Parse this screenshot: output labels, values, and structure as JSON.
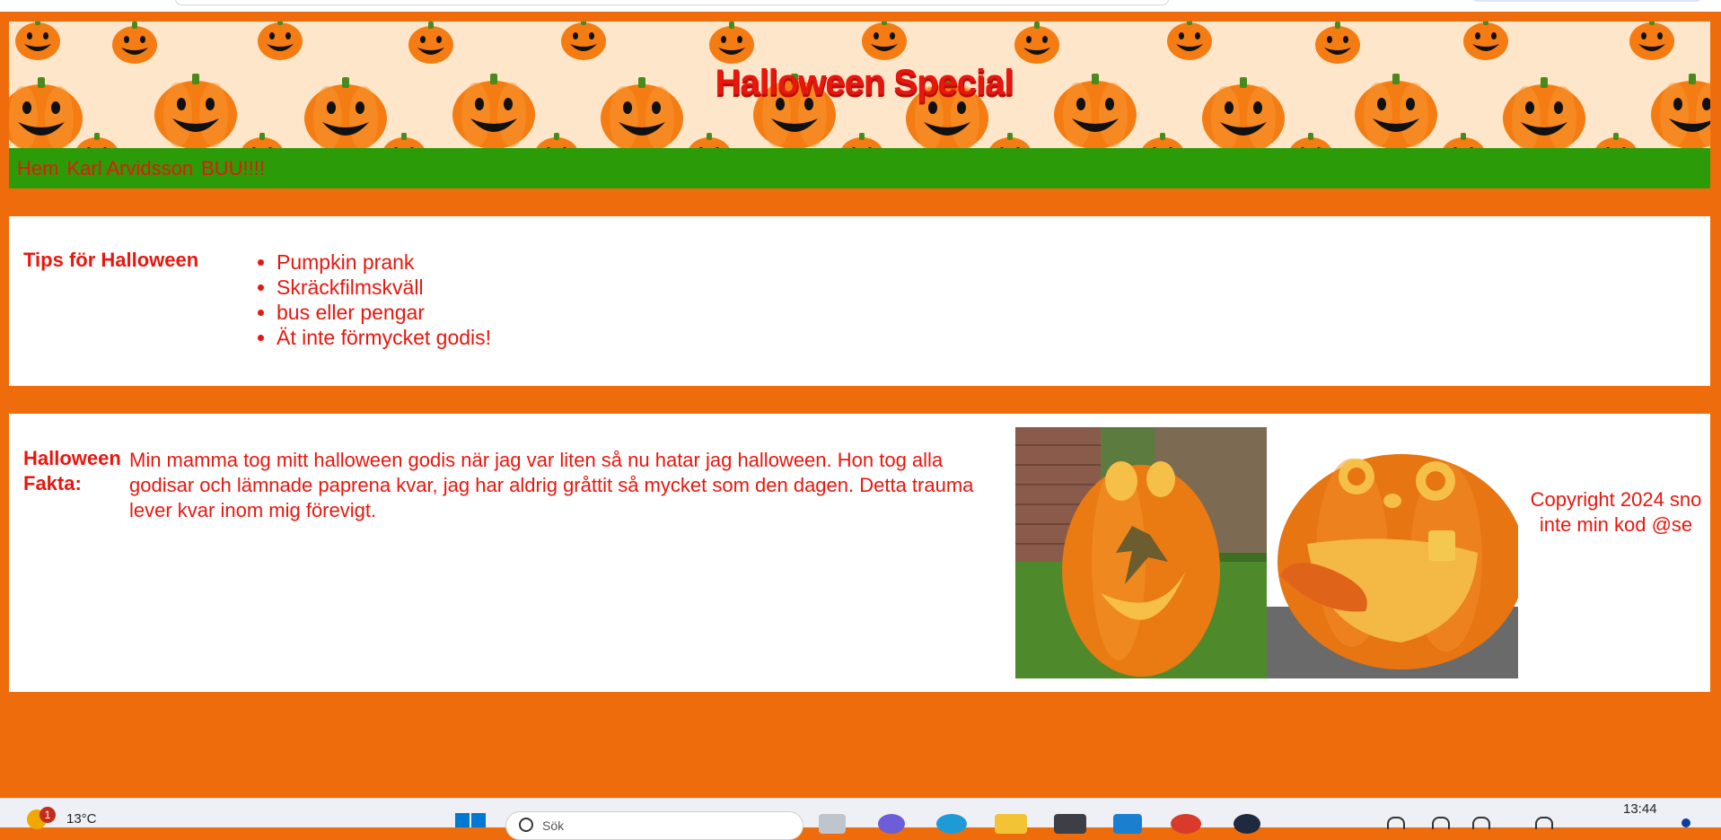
{
  "page": {
    "title": "Halloween Special",
    "background_color": "#ef6c0c",
    "accent_text_color": "#e8170e",
    "nav_color": "#2c9b08"
  },
  "nav": {
    "links": [
      "Hem",
      "Karl Arvidsson",
      "BUU!!!!"
    ]
  },
  "tips": {
    "heading": "Tips för Halloween",
    "items": [
      "Pumpkin prank",
      "Skräckfilmskväll",
      "bus eller pengar",
      "Ät inte förmycket godis!"
    ]
  },
  "facts": {
    "heading": "Halloween Fakta:",
    "text": "Min mamma tog mitt halloween godis när jag var liten så nu hatar jag halloween. Hon tog alla godisar och lämnade paprena kvar, jag har aldrig gråttit så mycket som den dagen. Detta trauma lever kvar inom mig förevigt.",
    "images": [
      "carved-pumpkin-photo",
      "tongue-pumpkin-photo"
    ],
    "copyright": "Copyright 2024 sno inte min kod @se"
  },
  "taskbar": {
    "weather_temp": "13°C",
    "weather_badge": "1",
    "search_placeholder": "Sök",
    "clock": "13:44"
  }
}
